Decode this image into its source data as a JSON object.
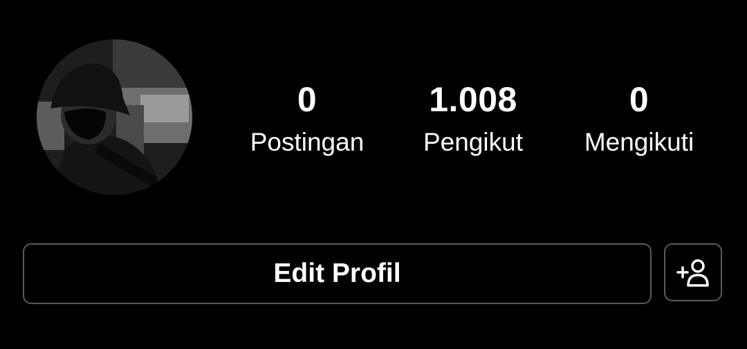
{
  "profile": {
    "avatar_icon": "profile-photo",
    "stats": [
      {
        "value": "0",
        "label": "Postingan"
      },
      {
        "value": "1.008",
        "label": "Pengikut"
      },
      {
        "value": "0",
        "label": "Mengikuti"
      }
    ]
  },
  "actions": {
    "edit_label": "Edit Profil",
    "add_icon": "add-person-icon"
  },
  "colors": {
    "background": "#000000",
    "text": "#ffffff",
    "border": "#5a5a5a"
  }
}
